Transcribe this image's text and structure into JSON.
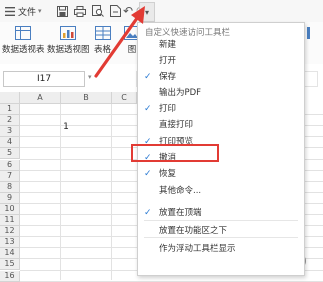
{
  "toolbar": {
    "file_label": "文件",
    "file_caret": "▾",
    "customize_caret": "▾"
  },
  "ribbon": {
    "tools": [
      {
        "label": "数据透视表",
        "icon": "pivot-table-icon"
      },
      {
        "label": "数据透视图",
        "icon": "pivot-chart-icon"
      },
      {
        "label": "表格",
        "icon": "table-icon"
      },
      {
        "label": "图",
        "icon": "image-icon"
      }
    ]
  },
  "formula_bar": {
    "name_box": "I17",
    "name_caret": "▾"
  },
  "grid": {
    "columns": [
      "A",
      "B",
      "C"
    ],
    "rows": [
      "1",
      "2",
      "3",
      "4",
      "5",
      "6",
      "7",
      "8",
      "9",
      "10",
      "11",
      "12",
      "13",
      "14",
      "15",
      "16"
    ],
    "cells": {
      "B2": "1"
    }
  },
  "dropdown": {
    "title": "自定义快速访问工具栏",
    "items": [
      {
        "label": "新建",
        "checked": false
      },
      {
        "label": "打开",
        "checked": false
      },
      {
        "label": "保存",
        "checked": true
      },
      {
        "label": "输出为PDF",
        "checked": false
      },
      {
        "label": "打印",
        "checked": true
      },
      {
        "label": "直接打印",
        "checked": false
      },
      {
        "label": "打印预览",
        "checked": true,
        "highlighted": true
      },
      {
        "label": "撤消",
        "checked": true
      },
      {
        "label": "恢复",
        "checked": true
      },
      {
        "label": "其他命令...",
        "checked": false
      },
      {
        "label": "放置在顶端",
        "checked": true
      },
      {
        "label": "放置在功能区之下",
        "checked": false
      },
      {
        "label": "作为浮动工具栏显示",
        "checked": false
      }
    ],
    "check_mark": "✓"
  },
  "colors": {
    "accent_check": "#2a7ad3",
    "annotation_red": "#e23b34"
  },
  "zoom_icon": "+"
}
